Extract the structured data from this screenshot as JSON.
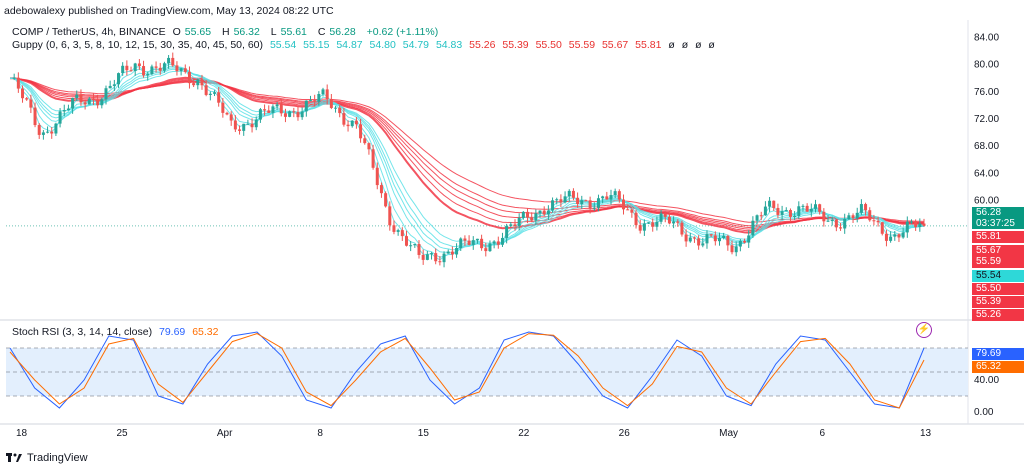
{
  "caption": "adebowalexy published on TradingView.com, May 13, 2024 08:22 UTC",
  "footer": {
    "brand": "TradingView",
    "logo_icon": "tradingview-logo-icon"
  },
  "legend": {
    "symbol": "COMP / TetherUS, 4h, BINANCE",
    "o_label": "O",
    "o_value": "55.65",
    "h_label": "H",
    "h_value": "56.32",
    "l_label": "L",
    "l_value": "55.61",
    "c_label": "C",
    "c_value": "56.28",
    "change": "+0.62 (+1.11%)",
    "guppy_title": "Guppy (0, 6, 3, 5, 8, 10, 12, 15, 30, 35, 40, 45, 50, 60)",
    "guppy_short": [
      "55.54",
      "55.15",
      "54.87",
      "54.80",
      "54.79",
      "54.83"
    ],
    "guppy_long": [
      "55.26",
      "55.39",
      "55.50",
      "55.59",
      "55.67",
      "55.81"
    ],
    "guppy_empty": [
      "ø",
      "ø",
      "ø",
      "ø"
    ],
    "stoch_title": "Stoch RSI (3, 3, 14, 14, close)",
    "stoch_k": "79.69",
    "stoch_d": "65.32"
  },
  "price_badges": {
    "current": "56.28",
    "countdown": "03:37:25",
    "long_emas": [
      "55.81",
      "55.67",
      "55.59"
    ],
    "short_ema": "55.54",
    "long_emas_2": [
      "55.50",
      "55.39",
      "55.26"
    ]
  },
  "stoch_badges": {
    "k": "79.69",
    "d": "65.32"
  },
  "colors": {
    "up": "#26a69a",
    "down": "#ef5350",
    "short_ema": "#5ce1e6",
    "long_ema": "#f23645",
    "stoch_k": "#2962ff",
    "stoch_d": "#ff6d00",
    "band_fill": "#e3effd"
  },
  "chart_data": [
    {
      "type": "candlestick",
      "title": "COMP / TetherUS, 4h, BINANCE",
      "y_ticks": [
        "84.00",
        "80.00",
        "76.00",
        "72.00",
        "68.00",
        "64.00",
        "60.00"
      ],
      "ylim": [
        43,
        86
      ],
      "x_ticks": [
        "18",
        "25",
        "Apr",
        "8",
        "15",
        "22",
        "26",
        "May",
        "6",
        "13"
      ],
      "approx_close_path": [
        {
          "x": "18",
          "y": 78
        },
        {
          "x": "20",
          "y": 70
        },
        {
          "x": "22",
          "y": 74
        },
        {
          "x": "25",
          "y": 76
        },
        {
          "x": "27",
          "y": 80
        },
        {
          "x": "29",
          "y": 79.5
        },
        {
          "x": "Apr",
          "y": 78
        },
        {
          "x": "3",
          "y": 71
        },
        {
          "x": "6",
          "y": 72.5
        },
        {
          "x": "8",
          "y": 73.5
        },
        {
          "x": "9",
          "y": 75
        },
        {
          "x": "11",
          "y": 71
        },
        {
          "x": "12",
          "y": 58
        },
        {
          "x": "13",
          "y": 51
        },
        {
          "x": "15",
          "y": 53
        },
        {
          "x": "17",
          "y": 53.5
        },
        {
          "x": "19",
          "y": 56
        },
        {
          "x": "20",
          "y": 59.5
        },
        {
          "x": "22",
          "y": 60
        },
        {
          "x": "24",
          "y": 60.5
        },
        {
          "x": "26",
          "y": 57
        },
        {
          "x": "28",
          "y": 56.5
        },
        {
          "x": "30",
          "y": 54
        },
        {
          "x": "May",
          "y": 53.5
        },
        {
          "x": "3",
          "y": 58.5
        },
        {
          "x": "6",
          "y": 59
        },
        {
          "x": "8",
          "y": 57
        },
        {
          "x": "10",
          "y": 58
        },
        {
          "x": "12",
          "y": 55
        },
        {
          "x": "13",
          "y": 56.28
        }
      ]
    },
    {
      "type": "line",
      "title": "Stoch RSI (3, 3, 14, 14, close)",
      "y_ticks": [
        "40.00",
        "0.00"
      ],
      "ylim": [
        -10,
        110
      ],
      "band": [
        20,
        80
      ],
      "series": [
        {
          "name": "K",
          "values": [
            80,
            30,
            5,
            40,
            95,
            90,
            20,
            10,
            60,
            95,
            100,
            70,
            15,
            5,
            50,
            85,
            95,
            40,
            10,
            30,
            90,
            100,
            95,
            60,
            20,
            5,
            45,
            90,
            70,
            20,
            8,
            60,
            95,
            90,
            50,
            10,
            5,
            80
          ]
        },
        {
          "name": "D",
          "values": [
            75,
            40,
            10,
            30,
            85,
            92,
            35,
            12,
            50,
            88,
            98,
            80,
            25,
            8,
            40,
            75,
            92,
            55,
            15,
            25,
            80,
            98,
            96,
            70,
            30,
            8,
            35,
            82,
            75,
            30,
            10,
            50,
            88,
            92,
            60,
            15,
            5,
            65
          ]
        }
      ]
    }
  ]
}
